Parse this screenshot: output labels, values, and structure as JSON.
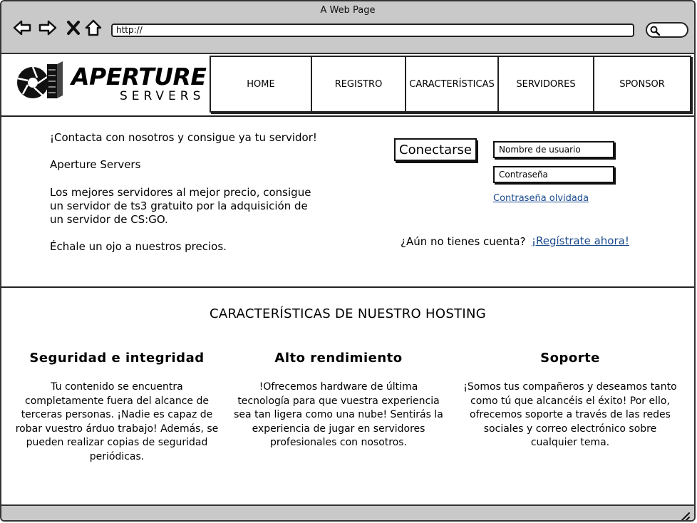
{
  "window": {
    "title": "A Web Page"
  },
  "browser": {
    "url": "http://"
  },
  "logo": {
    "name": "APERTURE",
    "sub": "SERVERS"
  },
  "nav": {
    "items": [
      {
        "label": "HOME"
      },
      {
        "label": "REGISTRO"
      },
      {
        "label": "CARACTERÍSTICAS"
      },
      {
        "label": "SERVIDORES"
      },
      {
        "label": "SPONSOR"
      }
    ]
  },
  "intro": {
    "line1": "¡Contacta con nosotros y consigue ya tu servidor!",
    "line2": "Aperture Servers",
    "line3": "Los mejores servidores al mejor precio, consigue un servidor de ts3 gratuito por la adquisición de un servidor de CS:GO.",
    "line4": "Échale un ojo a nuestros precios."
  },
  "login": {
    "connect_label": "Conectarse",
    "username_placeholder": "Nombre de usuario",
    "password_placeholder": "Contraseña",
    "forgot_label": "Contraseña olvidada",
    "no_account_text": "¿Aún no tienes cuenta?",
    "register_label": "¡Regístrate ahora!"
  },
  "features": {
    "title": "CARACTERÍSTICAS DE NUESTRO HOSTING",
    "items": [
      {
        "title": "Seguridad e integridad",
        "text": "Tu contenido se encuentra completamente fuera del alcance de terceras personas. ¡Nadie es capaz de robar vuestro árduo trabajo! Además, se pueden realizar copias de seguridad periódicas."
      },
      {
        "title": "Alto rendimiento",
        "text": "!Ofrecemos hardware de última tecnología para que vuestra experiencia sea tan ligera como una nube! Sentirás la experiencia de jugar en servidores profesionales con nosotros."
      },
      {
        "title": "Soporte",
        "text": "¡Somos tus compañeros y deseamos tanto como tú que alcancéis el éxito! Por ello, ofrecemos soporte a través de las redes sociales y correo electrónico sobre cualquier tema."
      }
    ]
  },
  "colors": {
    "chrome": "#c9c9c9",
    "link": "#1a4a8c",
    "border": "#222222"
  }
}
